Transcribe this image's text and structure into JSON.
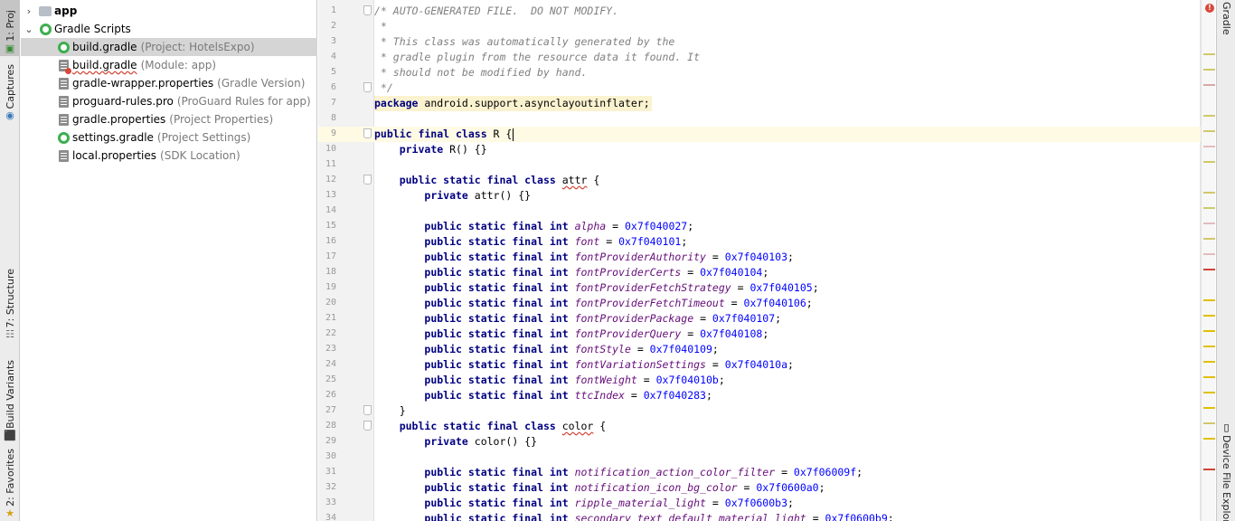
{
  "left_tabs": [
    {
      "label": "1: Proj",
      "icon": "project-icon",
      "glyph": "▣"
    },
    {
      "label": "Captures",
      "icon": "camera-icon",
      "glyph": "◉"
    },
    {
      "label": "7: Structure",
      "icon": "structure-icon",
      "glyph": "☷"
    },
    {
      "label": "Build Variants",
      "icon": "android-icon",
      "glyph": "⬛"
    },
    {
      "label": "2: Favorites",
      "icon": "star-icon",
      "glyph": "★"
    }
  ],
  "right_tabs": [
    {
      "label": "Gradle",
      "icon": "gradle-icon"
    },
    {
      "label": "Device File Explore",
      "icon": "device-icon",
      "glyph": "▯"
    }
  ],
  "tree": [
    {
      "name": "app",
      "hint": "",
      "icon": "folder-icon",
      "arrow": "›",
      "indent": 0,
      "bold": true,
      "selected": false,
      "wavy": false,
      "error": false
    },
    {
      "name": "Gradle Scripts",
      "hint": "",
      "icon": "gradle-icon",
      "arrow": "⌄",
      "indent": 0,
      "bold": false,
      "selected": false,
      "wavy": false,
      "error": false
    },
    {
      "name": "build.gradle",
      "hint": "(Project: HotelsExpo)",
      "icon": "gradle-icon",
      "arrow": "",
      "indent": 1,
      "bold": false,
      "selected": true,
      "wavy": false,
      "error": false
    },
    {
      "name": "build.gradle",
      "hint": "(Module: app)",
      "icon": "gradle-file-icon",
      "arrow": "",
      "indent": 1,
      "bold": false,
      "selected": false,
      "wavy": true,
      "error": true
    },
    {
      "name": "gradle-wrapper.properties",
      "hint": "(Gradle Version)",
      "icon": "properties-icon",
      "arrow": "",
      "indent": 1,
      "bold": false,
      "selected": false,
      "wavy": false,
      "error": false
    },
    {
      "name": "proguard-rules.pro",
      "hint": "(ProGuard Rules for app)",
      "icon": "text-file-icon",
      "arrow": "",
      "indent": 1,
      "bold": false,
      "selected": false,
      "wavy": false,
      "error": false
    },
    {
      "name": "gradle.properties",
      "hint": "(Project Properties)",
      "icon": "properties-icon",
      "arrow": "",
      "indent": 1,
      "bold": false,
      "selected": false,
      "wavy": false,
      "error": false
    },
    {
      "name": "settings.gradle",
      "hint": "(Project Settings)",
      "icon": "gradle-icon",
      "arrow": "",
      "indent": 1,
      "bold": false,
      "selected": false,
      "wavy": false,
      "error": false
    },
    {
      "name": "local.properties",
      "hint": "(SDK Location)",
      "icon": "properties-icon",
      "arrow": "",
      "indent": 1,
      "bold": false,
      "selected": false,
      "wavy": false,
      "error": false
    }
  ],
  "editor": {
    "current_line": 9,
    "fold_lines": [
      1,
      6,
      9,
      12,
      27,
      28
    ],
    "lines": [
      [
        {
          "t": "cm",
          "v": "/* AUTO-GENERATED FILE.  DO NOT MODIFY."
        }
      ],
      [
        {
          "t": "cm",
          "v": " *"
        }
      ],
      [
        {
          "t": "cm",
          "v": " * This class was automatically generated by the"
        }
      ],
      [
        {
          "t": "cm",
          "v": " * gradle plugin from the resource data it found. It"
        }
      ],
      [
        {
          "t": "cm",
          "v": " * should not be modified by hand."
        }
      ],
      [
        {
          "t": "cm",
          "v": " */"
        }
      ],
      [
        {
          "t": "kw",
          "v": "package"
        },
        {
          "t": "p",
          "v": " android.support.asynclayoutinflater;"
        }
      ],
      [],
      [
        {
          "t": "kw",
          "v": "public final class"
        },
        {
          "t": "p",
          "v": " R {"
        },
        {
          "t": "caret",
          "v": ""
        }
      ],
      [
        {
          "t": "p",
          "v": "    "
        },
        {
          "t": "kw",
          "v": "private"
        },
        {
          "t": "p",
          "v": " R() {}"
        }
      ],
      [],
      [
        {
          "t": "p",
          "v": "    "
        },
        {
          "t": "kw",
          "v": "public static final class"
        },
        {
          "t": "p",
          "v": " "
        },
        {
          "t": "wv",
          "v": "attr"
        },
        {
          "t": "p",
          "v": " {"
        }
      ],
      [
        {
          "t": "p",
          "v": "        "
        },
        {
          "t": "kw",
          "v": "private"
        },
        {
          "t": "p",
          "v": " attr() {}"
        }
      ],
      [],
      [
        {
          "t": "p",
          "v": "        "
        },
        {
          "t": "kw",
          "v": "public static final int"
        },
        {
          "t": "p",
          "v": " "
        },
        {
          "t": "fld",
          "v": "alpha"
        },
        {
          "t": "p",
          "v": " = "
        },
        {
          "t": "num",
          "v": "0x7f040027"
        },
        {
          "t": "p",
          "v": ";"
        }
      ],
      [
        {
          "t": "p",
          "v": "        "
        },
        {
          "t": "kw",
          "v": "public static final int"
        },
        {
          "t": "p",
          "v": " "
        },
        {
          "t": "fld",
          "v": "font"
        },
        {
          "t": "p",
          "v": " = "
        },
        {
          "t": "num",
          "v": "0x7f040101"
        },
        {
          "t": "p",
          "v": ";"
        }
      ],
      [
        {
          "t": "p",
          "v": "        "
        },
        {
          "t": "kw",
          "v": "public static final int"
        },
        {
          "t": "p",
          "v": " "
        },
        {
          "t": "fld",
          "v": "fontProviderAuthority"
        },
        {
          "t": "p",
          "v": " = "
        },
        {
          "t": "num",
          "v": "0x7f040103"
        },
        {
          "t": "p",
          "v": ";"
        }
      ],
      [
        {
          "t": "p",
          "v": "        "
        },
        {
          "t": "kw",
          "v": "public static final int"
        },
        {
          "t": "p",
          "v": " "
        },
        {
          "t": "fld",
          "v": "fontProviderCerts"
        },
        {
          "t": "p",
          "v": " = "
        },
        {
          "t": "num",
          "v": "0x7f040104"
        },
        {
          "t": "p",
          "v": ";"
        }
      ],
      [
        {
          "t": "p",
          "v": "        "
        },
        {
          "t": "kw",
          "v": "public static final int"
        },
        {
          "t": "p",
          "v": " "
        },
        {
          "t": "fld",
          "v": "fontProviderFetchStrategy"
        },
        {
          "t": "p",
          "v": " = "
        },
        {
          "t": "num",
          "v": "0x7f040105"
        },
        {
          "t": "p",
          "v": ";"
        }
      ],
      [
        {
          "t": "p",
          "v": "        "
        },
        {
          "t": "kw",
          "v": "public static final int"
        },
        {
          "t": "p",
          "v": " "
        },
        {
          "t": "fld",
          "v": "fontProviderFetchTimeout"
        },
        {
          "t": "p",
          "v": " = "
        },
        {
          "t": "num",
          "v": "0x7f040106"
        },
        {
          "t": "p",
          "v": ";"
        }
      ],
      [
        {
          "t": "p",
          "v": "        "
        },
        {
          "t": "kw",
          "v": "public static final int"
        },
        {
          "t": "p",
          "v": " "
        },
        {
          "t": "fld",
          "v": "fontProviderPackage"
        },
        {
          "t": "p",
          "v": " = "
        },
        {
          "t": "num",
          "v": "0x7f040107"
        },
        {
          "t": "p",
          "v": ";"
        }
      ],
      [
        {
          "t": "p",
          "v": "        "
        },
        {
          "t": "kw",
          "v": "public static final int"
        },
        {
          "t": "p",
          "v": " "
        },
        {
          "t": "fld",
          "v": "fontProviderQuery"
        },
        {
          "t": "p",
          "v": " = "
        },
        {
          "t": "num",
          "v": "0x7f040108"
        },
        {
          "t": "p",
          "v": ";"
        }
      ],
      [
        {
          "t": "p",
          "v": "        "
        },
        {
          "t": "kw",
          "v": "public static final int"
        },
        {
          "t": "p",
          "v": " "
        },
        {
          "t": "fld",
          "v": "fontStyle"
        },
        {
          "t": "p",
          "v": " = "
        },
        {
          "t": "num",
          "v": "0x7f040109"
        },
        {
          "t": "p",
          "v": ";"
        }
      ],
      [
        {
          "t": "p",
          "v": "        "
        },
        {
          "t": "kw",
          "v": "public static final int"
        },
        {
          "t": "p",
          "v": " "
        },
        {
          "t": "fld",
          "v": "fontVariationSettings"
        },
        {
          "t": "p",
          "v": " = "
        },
        {
          "t": "num",
          "v": "0x7f04010a"
        },
        {
          "t": "p",
          "v": ";"
        }
      ],
      [
        {
          "t": "p",
          "v": "        "
        },
        {
          "t": "kw",
          "v": "public static final int"
        },
        {
          "t": "p",
          "v": " "
        },
        {
          "t": "fld",
          "v": "fontWeight"
        },
        {
          "t": "p",
          "v": " = "
        },
        {
          "t": "num",
          "v": "0x7f04010b"
        },
        {
          "t": "p",
          "v": ";"
        }
      ],
      [
        {
          "t": "p",
          "v": "        "
        },
        {
          "t": "kw",
          "v": "public static final int"
        },
        {
          "t": "p",
          "v": " "
        },
        {
          "t": "fld",
          "v": "ttcIndex"
        },
        {
          "t": "p",
          "v": " = "
        },
        {
          "t": "num",
          "v": "0x7f040283"
        },
        {
          "t": "p",
          "v": ";"
        }
      ],
      [
        {
          "t": "p",
          "v": "    }"
        }
      ],
      [
        {
          "t": "p",
          "v": "    "
        },
        {
          "t": "kw",
          "v": "public static final class"
        },
        {
          "t": "p",
          "v": " "
        },
        {
          "t": "wv",
          "v": "color"
        },
        {
          "t": "p",
          "v": " {"
        }
      ],
      [
        {
          "t": "p",
          "v": "        "
        },
        {
          "t": "kw",
          "v": "private"
        },
        {
          "t": "p",
          "v": " color() {}"
        }
      ],
      [],
      [
        {
          "t": "p",
          "v": "        "
        },
        {
          "t": "kw",
          "v": "public static final int"
        },
        {
          "t": "p",
          "v": " "
        },
        {
          "t": "fld",
          "v": "notification_action_color_filter"
        },
        {
          "t": "p",
          "v": " = "
        },
        {
          "t": "num",
          "v": "0x7f06009f"
        },
        {
          "t": "p",
          "v": ";"
        }
      ],
      [
        {
          "t": "p",
          "v": "        "
        },
        {
          "t": "kw",
          "v": "public static final int"
        },
        {
          "t": "p",
          "v": " "
        },
        {
          "t": "fld",
          "v": "notification_icon_bg_color"
        },
        {
          "t": "p",
          "v": " = "
        },
        {
          "t": "num",
          "v": "0x7f0600a0"
        },
        {
          "t": "p",
          "v": ";"
        }
      ],
      [
        {
          "t": "p",
          "v": "        "
        },
        {
          "t": "kw",
          "v": "public static final int"
        },
        {
          "t": "p",
          "v": " "
        },
        {
          "t": "fld",
          "v": "ripple_material_light"
        },
        {
          "t": "p",
          "v": " = "
        },
        {
          "t": "num",
          "v": "0x7f0600b3"
        },
        {
          "t": "p",
          "v": ";"
        }
      ],
      [
        {
          "t": "p",
          "v": "        "
        },
        {
          "t": "kw",
          "v": "public static final int"
        },
        {
          "t": "p",
          "v": " "
        },
        {
          "t": "fld",
          "v": "secondary_text_default_material_light"
        },
        {
          "t": "p",
          "v": " = "
        },
        {
          "t": "num",
          "v": "0x7f0600b9"
        },
        {
          "t": "p",
          "v": ";"
        }
      ]
    ]
  },
  "error_stripe": {
    "badge": "!",
    "marks": [
      {
        "row": 3,
        "color": "#cfc96a"
      },
      {
        "row": 4,
        "color": "#cfc96a"
      },
      {
        "row": 5,
        "color": "#d9a8a8"
      },
      {
        "row": 7,
        "color": "#cfc96a"
      },
      {
        "row": 8,
        "color": "#cfc96a"
      },
      {
        "row": 9,
        "color": "#e2bdbd"
      },
      {
        "row": 10,
        "color": "#cfc96a"
      },
      {
        "row": 12,
        "color": "#cfc96a"
      },
      {
        "row": 13,
        "color": "#cfc96a"
      },
      {
        "row": 14,
        "color": "#e2bdbd"
      },
      {
        "row": 15,
        "color": "#cfc96a"
      },
      {
        "row": 16,
        "color": "#e2bdbd"
      },
      {
        "row": 17,
        "color": "#d04437"
      },
      {
        "row": 19,
        "color": "#e0c000"
      },
      {
        "row": 20,
        "color": "#e0c000"
      },
      {
        "row": 21,
        "color": "#e0c000"
      },
      {
        "row": 22,
        "color": "#e0c000"
      },
      {
        "row": 23,
        "color": "#e0c000"
      },
      {
        "row": 24,
        "color": "#e0c000"
      },
      {
        "row": 25,
        "color": "#e0c000"
      },
      {
        "row": 26,
        "color": "#e0c000"
      },
      {
        "row": 27,
        "color": "#cfc96a"
      },
      {
        "row": 28,
        "color": "#e0c000"
      },
      {
        "row": 30,
        "color": "#d04437"
      }
    ]
  }
}
